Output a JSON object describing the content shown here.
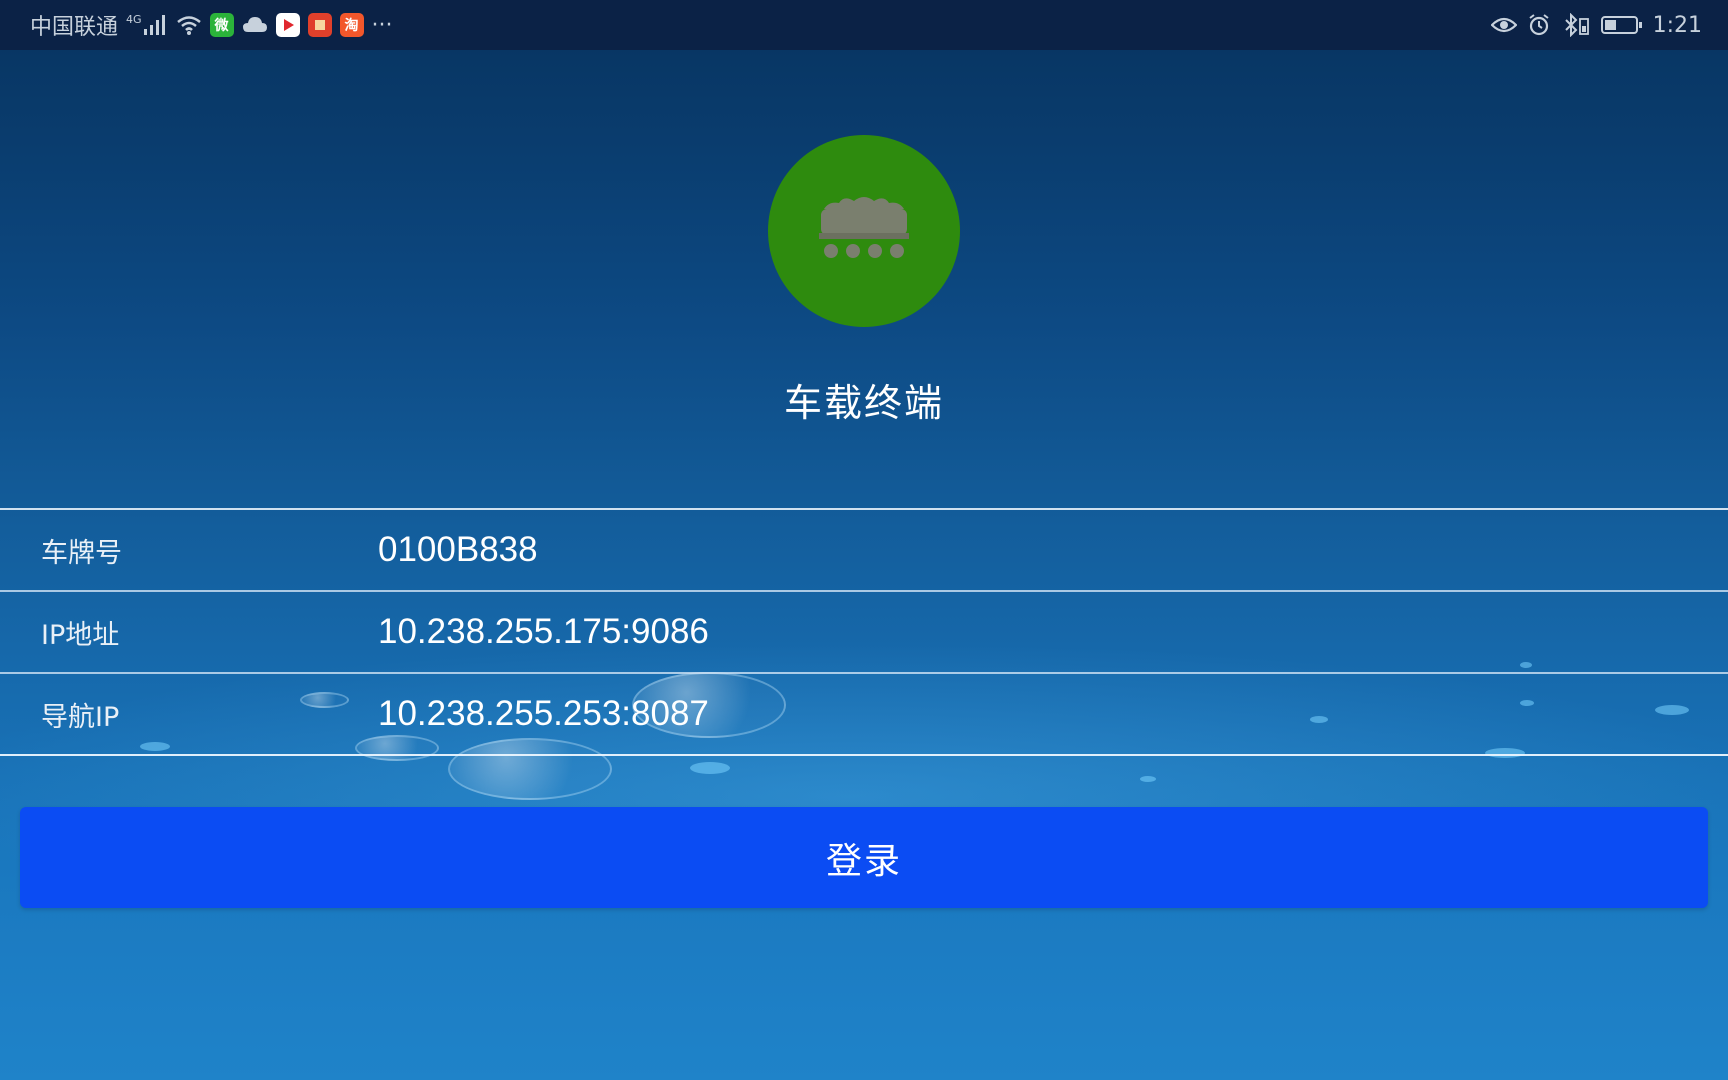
{
  "status_bar": {
    "carrier": "中国联通",
    "network": "4G",
    "more": "···",
    "time": "1:21",
    "left_icons": [
      "signal-icon",
      "wifi-icon",
      "wechat-app-icon",
      "cloud-icon",
      "video-app-icon",
      "news-app-icon",
      "taobao-app-icon"
    ],
    "app_badges": {
      "wechat": "微",
      "taobao": "淘"
    },
    "right_icons": [
      "eye-icon",
      "alarm-icon",
      "bluetooth-icon",
      "battery-icon"
    ]
  },
  "header": {
    "logo_icon": "vehicle-terminal-icon",
    "logo_color": "#2e8b0e",
    "title": "车载终端"
  },
  "form": {
    "rows": [
      {
        "label": "车牌号",
        "value": "0100B838"
      },
      {
        "label": "IP地址",
        "value": "10.238.255.175:9086"
      },
      {
        "label": "导航IP",
        "value": "10.238.255.253:8087"
      }
    ]
  },
  "login_button": {
    "label": "登录",
    "color": "#0b4cf3"
  }
}
